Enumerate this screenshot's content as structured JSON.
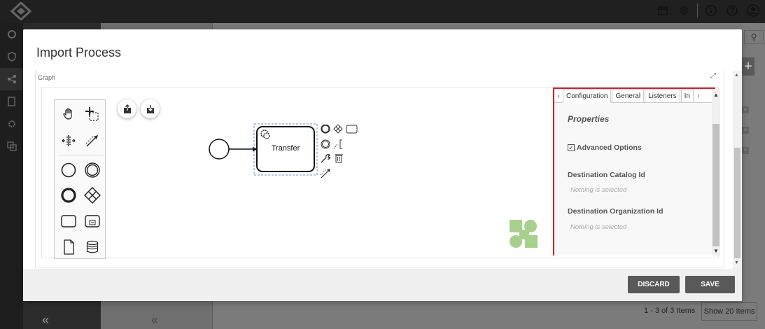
{
  "modal": {
    "title": "Import Process",
    "graph_label": "Graph",
    "discard_label": "DISCARD",
    "save_label": "SAVE"
  },
  "diagram": {
    "task_label": "Transfer"
  },
  "properties": {
    "tabs": [
      "Configuration",
      "General",
      "Listeners",
      "In"
    ],
    "active_tab": "Configuration",
    "heading": "Properties",
    "advanced_options_label": "Advanced Options",
    "advanced_options_checked": true,
    "fields": [
      {
        "label": "Destination Catalog Id",
        "value": "Nothing is selected"
      },
      {
        "label": "Destination Organization Id",
        "value": "Nothing is selected"
      }
    ]
  },
  "background": {
    "pager_text": "1 - 3 of 3 Items",
    "show_items_label": "Show 20 Items"
  },
  "colors": {
    "highlight": "#d32028",
    "button": "#595959",
    "watermark": "#a8d08d"
  }
}
